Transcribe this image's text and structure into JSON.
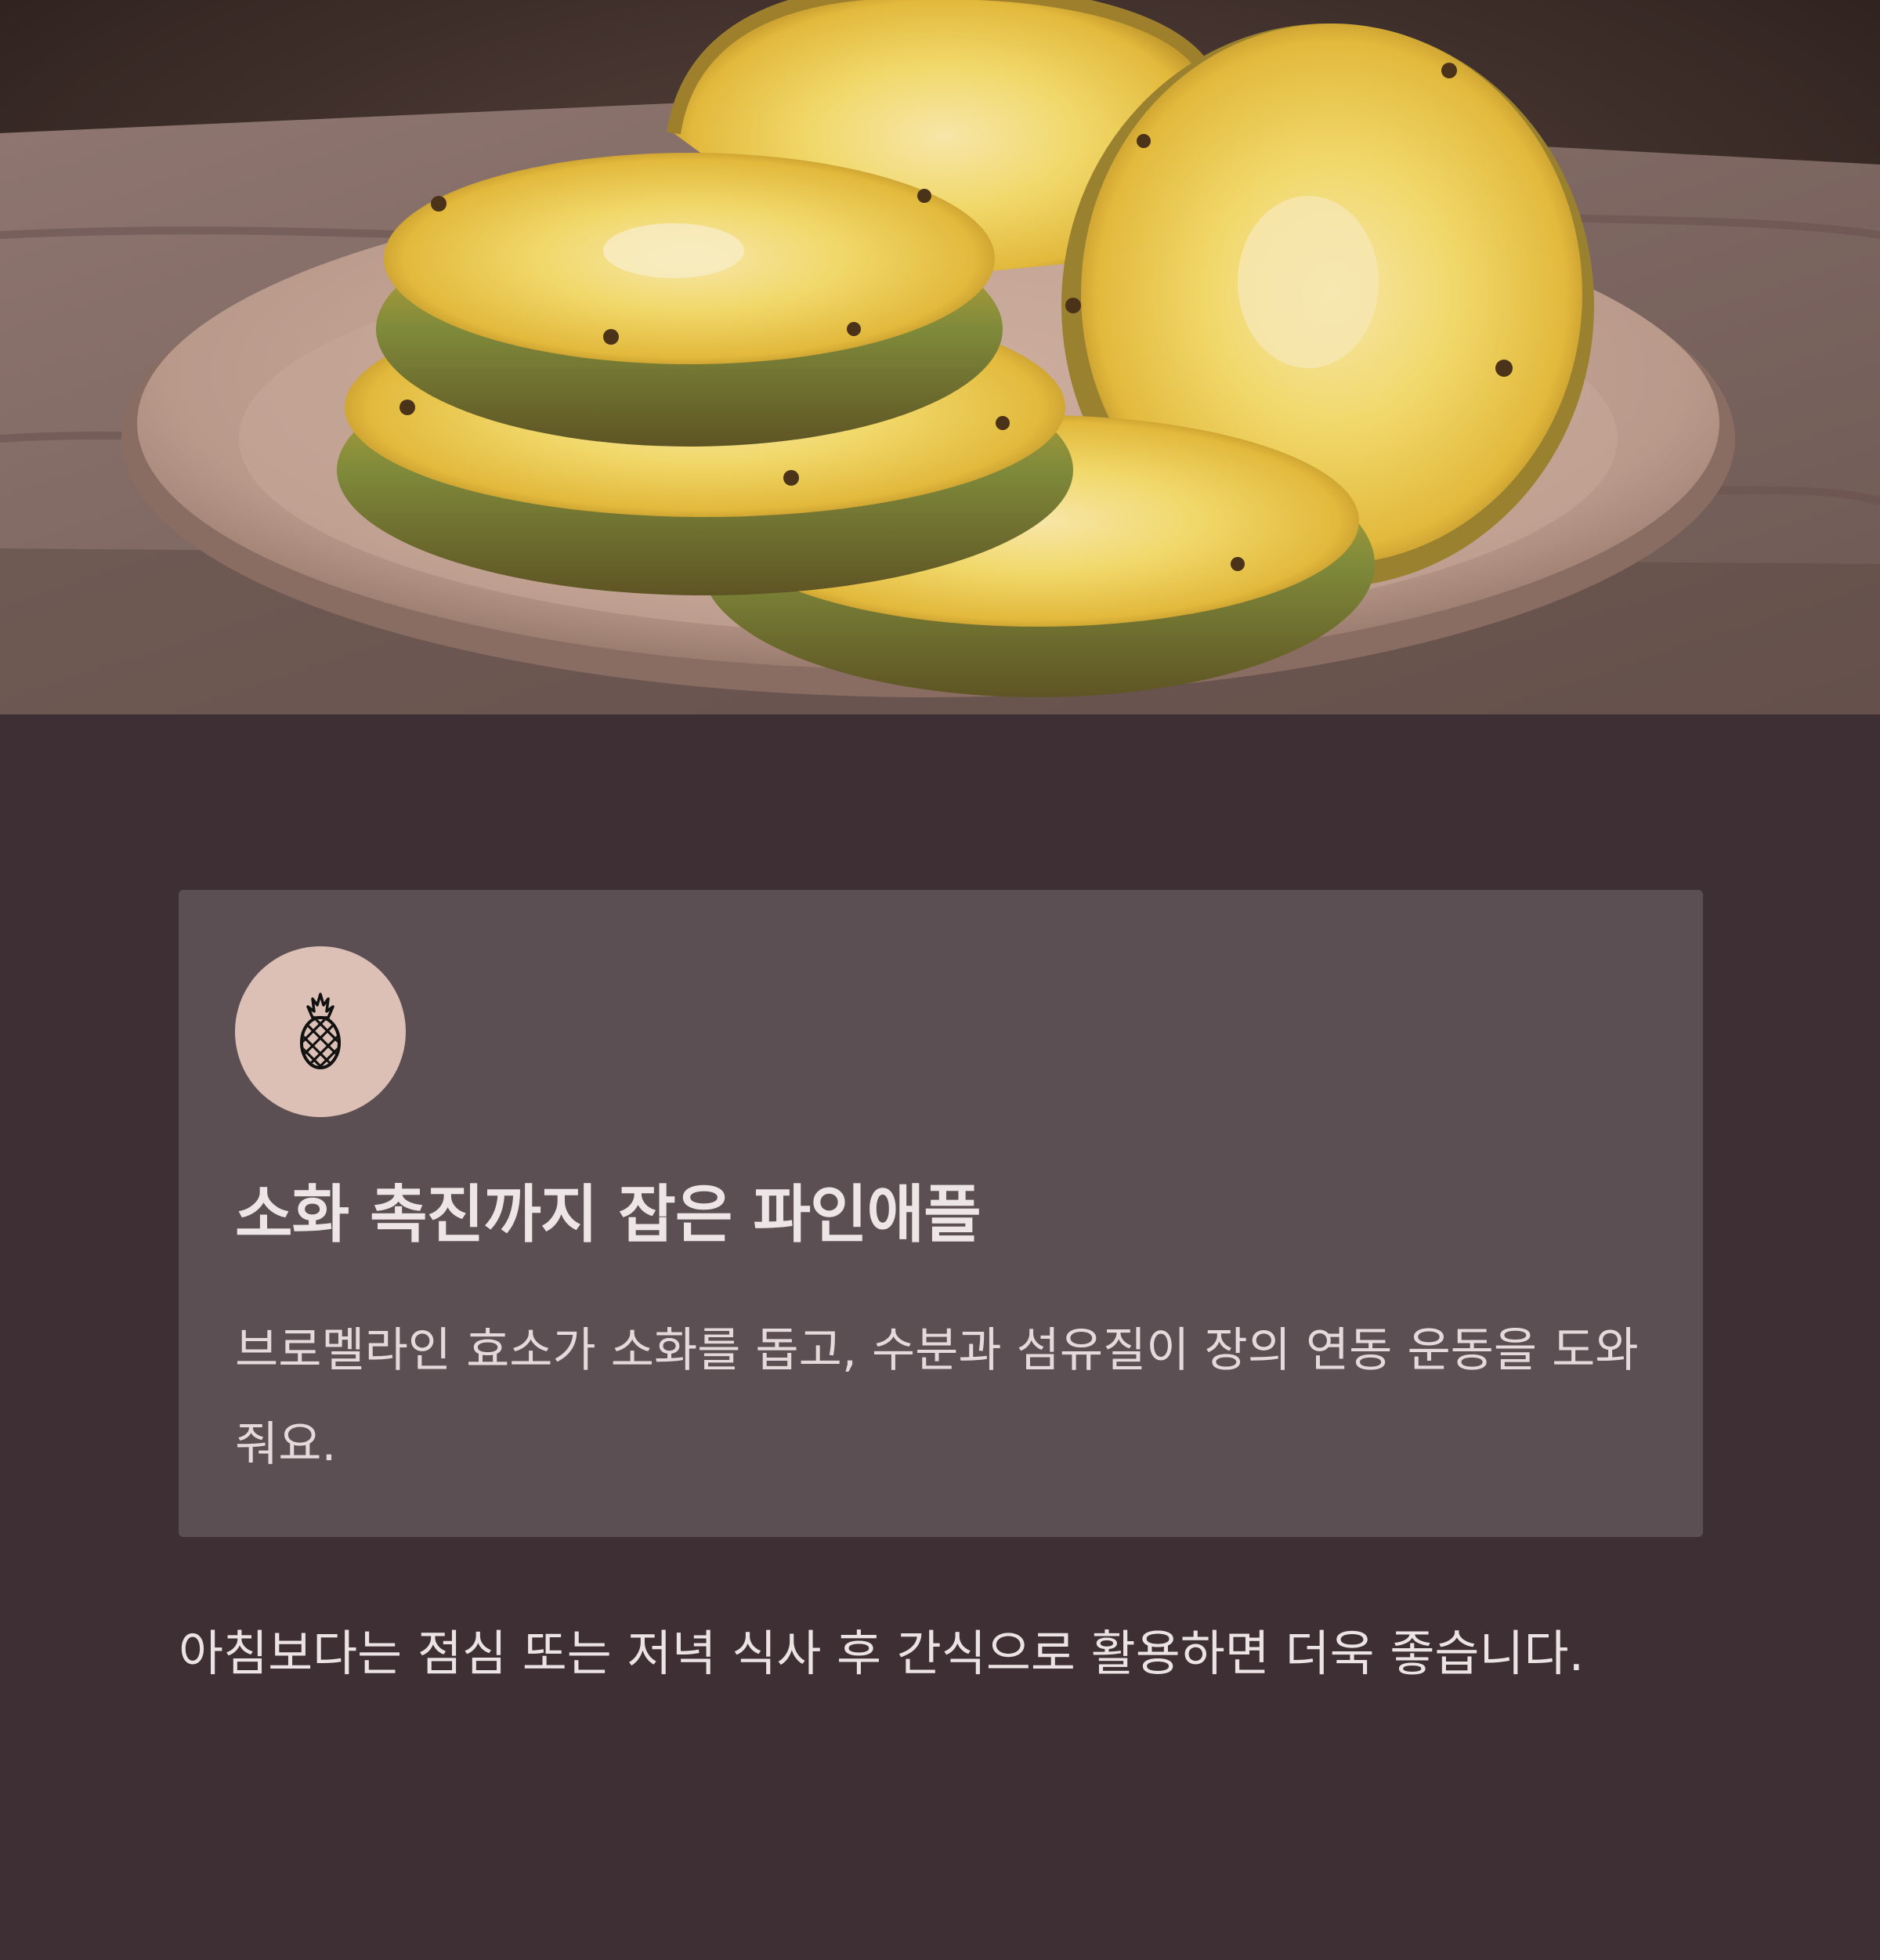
{
  "hero": {
    "image": "pineapple-slices-on-plate-photo"
  },
  "card": {
    "icon": "pineapple-icon",
    "icon_background": "#dcc0b5",
    "title": "소화 촉진까지 잡은 파인애플",
    "description": "브로멜라인 효소가 소화를 돕고, 수분과 섬유질이 장의 연동 운동을 도와줘요."
  },
  "note": {
    "text": "아침보다는 점심 또는 저녁 식사 후 간식으로 활용하면 더욱 좋습니다."
  },
  "colors": {
    "page_background": "#3d2f33",
    "card_background": "#5c4f53",
    "text": "#ece3e4"
  }
}
